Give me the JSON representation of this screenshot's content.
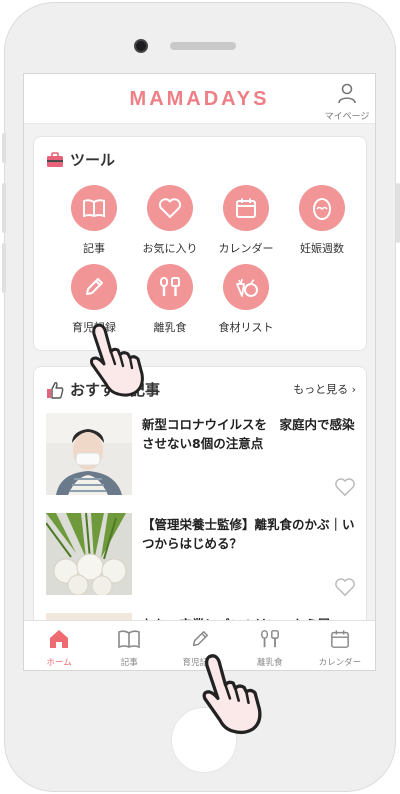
{
  "app": {
    "logo": "MAMADAYS"
  },
  "header": {
    "mypage_label": "マイページ"
  },
  "tools": {
    "title": "ツール",
    "items": [
      {
        "label": "記事",
        "icon": "book-icon"
      },
      {
        "label": "お気に入り",
        "icon": "heart-icon"
      },
      {
        "label": "カレンダー",
        "icon": "calendar-icon"
      },
      {
        "label": "妊娠週数",
        "icon": "egg-icon"
      },
      {
        "label": "育児記録",
        "icon": "pencil-icon"
      },
      {
        "label": "離乳食",
        "icon": "utensils-icon"
      },
      {
        "label": "食材リスト",
        "icon": "apple-carrot-icon"
      }
    ]
  },
  "articles": {
    "title": "おすすめ記事",
    "more_label": "もっと見る",
    "items": [
      {
        "title": "新型コロナウイルスを　家庭内で感染させない8個の注意点"
      },
      {
        "title": "【管理栄養士監修】離乳食のかぶ｜いつからはじめる？"
      },
      {
        "title": "おむつ卒業！パンツはいつから履"
      }
    ]
  },
  "tabbar": {
    "items": [
      {
        "label": "ホーム",
        "active": true
      },
      {
        "label": "記事",
        "active": false
      },
      {
        "label": "育児記録",
        "active": false
      },
      {
        "label": "離乳食",
        "active": false
      },
      {
        "label": "カレンダー",
        "active": false
      }
    ]
  },
  "colors": {
    "accent": "#ee7f86",
    "tool_circle": "#f19597",
    "active_tab": "#ee6b72"
  }
}
